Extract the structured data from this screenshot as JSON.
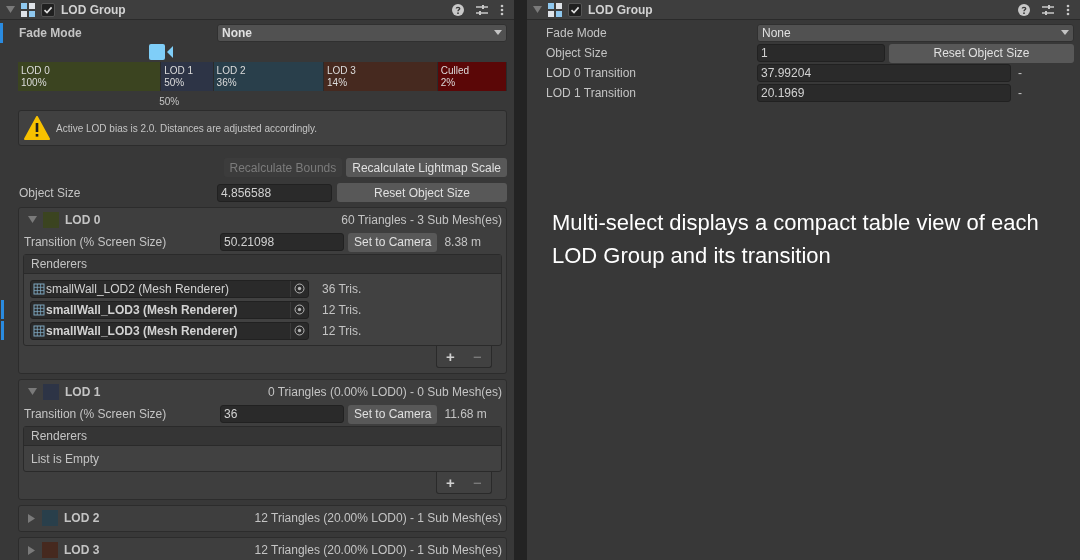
{
  "left_inspector": {
    "header": {
      "title": "LOD Group",
      "enabled": true
    },
    "fade_mode": {
      "label": "Fade Mode",
      "value": "None",
      "overridden": true
    },
    "lod_bar": {
      "segments": [
        {
          "name": "LOD 0",
          "percent": "100%",
          "color": "#3b4420"
        },
        {
          "name": "LOD 1",
          "percent": "50%",
          "color": "#2d3446"
        },
        {
          "name": "LOD 2",
          "percent": "36%",
          "color": "#293f4b"
        },
        {
          "name": "LOD 3",
          "percent": "14%",
          "color": "#46291f"
        },
        {
          "name": "Culled",
          "percent": "2%",
          "color": "#5b0707"
        }
      ],
      "camera_label": "50%"
    },
    "warning": "Active LOD bias is 2.0. Distances are adjusted accordingly.",
    "buttons": [
      {
        "label": "Recalculate Bounds",
        "disabled": true
      },
      {
        "label": "Recalculate Lightmap Scale",
        "disabled": false
      }
    ],
    "object_size": {
      "label": "Object Size",
      "value": "4.856588",
      "button": "Reset Object Size"
    },
    "lods": [
      {
        "name": "LOD 0",
        "color": "#3b4420",
        "summary": "60 Triangles  - 3 Sub Mesh(es)",
        "expanded": true,
        "transition_label": "Transition (% Screen Size)",
        "transition": "50.21098",
        "button": "Set to Camera",
        "distance": "8.38 m",
        "renderers_title": "Renderers",
        "renderers": [
          {
            "name": "smallWall_LOD2 (Mesh Renderer)",
            "tris": "36 Tris.",
            "overridden": false
          },
          {
            "name": "smallWall_LOD3 (Mesh Renderer)",
            "tris": "12 Tris.",
            "overridden": true
          },
          {
            "name": "smallWall_LOD3 (Mesh Renderer)",
            "tris": "12 Tris.",
            "overridden": true
          }
        ],
        "add": "+",
        "remove": "−"
      },
      {
        "name": "LOD 1",
        "color": "#2d3446",
        "summary": "0 Triangles (0.00% LOD0) - 0 Sub Mesh(es)",
        "expanded": true,
        "transition_label": "Transition (% Screen Size)",
        "transition": "36",
        "button": "Set to Camera",
        "distance": "11.68 m",
        "renderers_title": "Renderers",
        "empty_text": "List is Empty",
        "add": "+",
        "remove": "−"
      },
      {
        "name": "LOD 2",
        "color": "#293f4b",
        "summary": "12 Triangles (20.00% LOD0) - 1 Sub Mesh(es)",
        "expanded": false
      },
      {
        "name": "LOD 3",
        "color": "#46291f",
        "summary": "12 Triangles (20.00% LOD0) - 1 Sub Mesh(es)",
        "expanded": false
      }
    ]
  },
  "right_inspector": {
    "header": {
      "title": "LOD Group",
      "enabled": true
    },
    "rows": [
      {
        "kind": "dropdown",
        "label": "Fade Mode",
        "value": "None"
      },
      {
        "kind": "size",
        "label": "Object Size",
        "value": "1",
        "button": "Reset Object Size"
      },
      {
        "kind": "transition",
        "label": "LOD 0 Transition",
        "value": "37.99204",
        "suffix": "-"
      },
      {
        "kind": "transition",
        "label": "LOD 1 Transition",
        "value": "20.1969",
        "suffix": "-"
      }
    ],
    "caption": "Multi-select displays a compact table view of each LOD Group and its transition"
  }
}
